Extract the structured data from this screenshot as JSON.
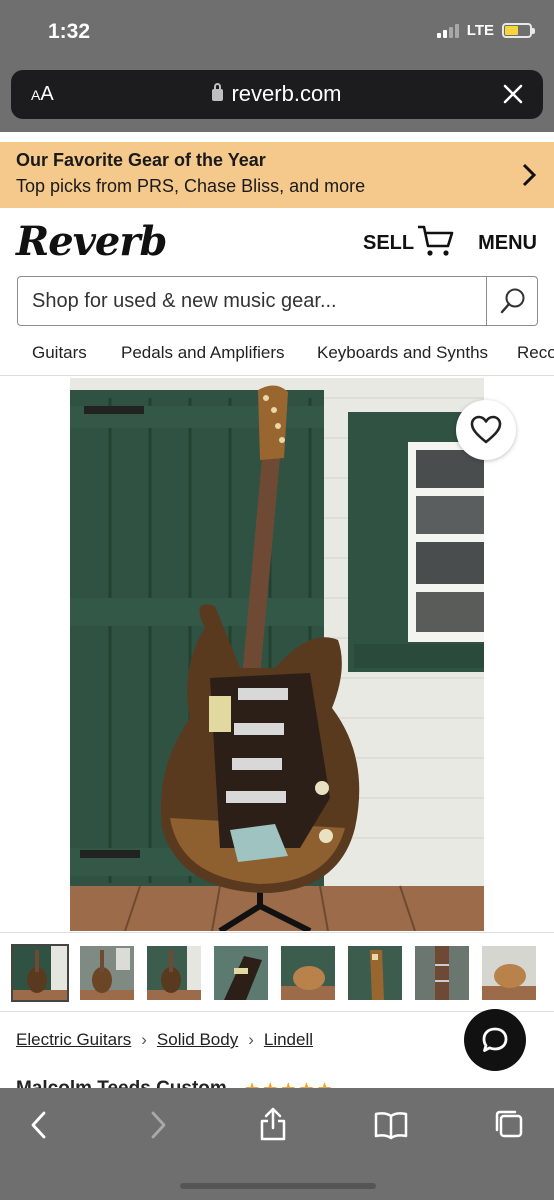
{
  "status_bar": {
    "time": "1:32",
    "network": "LTE"
  },
  "browser": {
    "aa_label": "AA",
    "url": "reverb.com"
  },
  "promo": {
    "title": "Our Favorite Gear of the Year",
    "subtitle": "Top picks from PRS, Chase Bliss, and more"
  },
  "header": {
    "logo": "Reverb",
    "sell_label": "SELL",
    "menu_label": "MENU"
  },
  "search": {
    "placeholder": "Shop for used & new music gear..."
  },
  "categories": [
    "Guitars",
    "Pedals and Amplifiers",
    "Keyboards and Synths",
    "Reco"
  ],
  "breadcrumb": [
    "Electric Guitars",
    "Solid Body",
    "Lindell"
  ],
  "listing_peek": {
    "title": "Malcolm Teeds Custom",
    "stars": "★★★★★"
  },
  "colors": {
    "promo_bg": "#f5c98b",
    "chrome_gray": "#6f6f6f",
    "star": "#e8a33d"
  },
  "thumbnail_count": 8
}
